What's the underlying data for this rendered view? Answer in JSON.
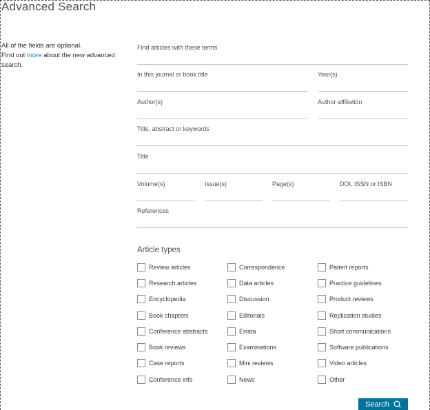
{
  "page_title": "Advanced Search",
  "sidebar": {
    "optional_note": "All of the fields are optional.",
    "find_out_prefix": "Find out ",
    "more_link": "more",
    "find_out_suffix": " about the new advanced search."
  },
  "fields": {
    "terms": "Find articles with these terms",
    "journal": "In this journal or book title",
    "years": "Year(s)",
    "authors": "Author(s)",
    "affiliation": "Author affiliation",
    "keywords": "Title, abstract or keywords",
    "title": "Title",
    "volume": "Volume(s)",
    "issue": "Issue(s)",
    "pages": "Page(s)",
    "doi": "DOI, ISSN or ISBN",
    "references": "References"
  },
  "article_types": {
    "heading": "Article types",
    "items": [
      "Review articles",
      "Correspondence",
      "Patent reports",
      "Research articles",
      "Data articles",
      "Practice guidelines",
      "Encyclopedia",
      "Discussion",
      "Product reviews",
      "Book chapters",
      "Editorials",
      "Replication studies",
      "Conference abstracts",
      "Errata",
      "Short communications",
      "Book reviews",
      "Examinations",
      "Software publications",
      "Case reports",
      "Mini reviews",
      "Video articles",
      "Conference info",
      "News",
      "Other"
    ]
  },
  "search_button": {
    "label": "Search",
    "icon": "search-icon"
  },
  "colors": {
    "accent": "#007398",
    "link": "#0c7dbb"
  }
}
